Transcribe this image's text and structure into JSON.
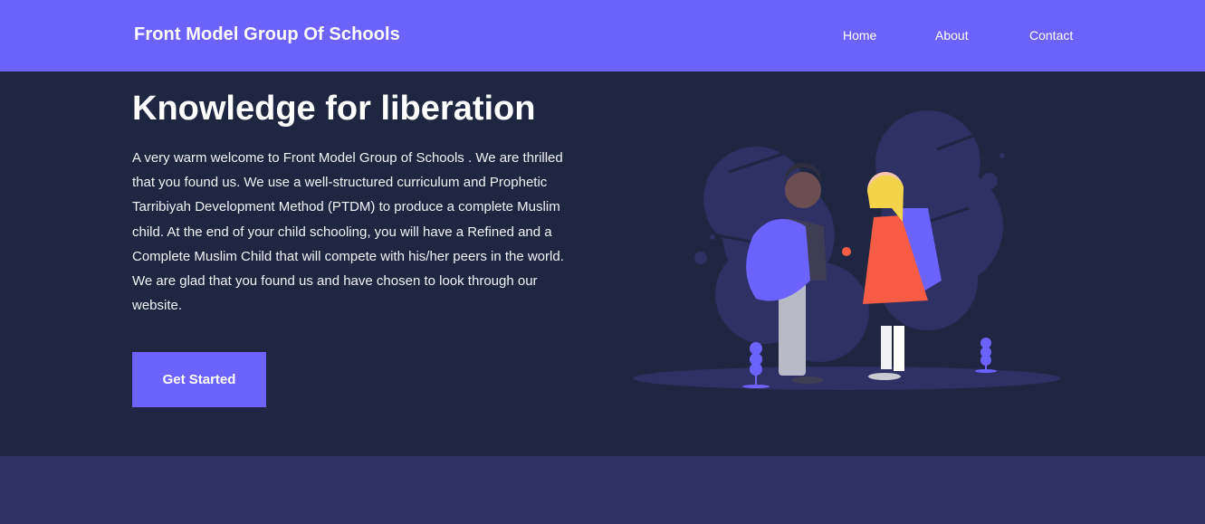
{
  "nav": {
    "brand": "Front Model Group Of Schools",
    "links": [
      "Home",
      "About",
      "Contact"
    ]
  },
  "hero": {
    "title": "Knowledge for liberation",
    "description": "A very warm welcome to Front Model Group of Schools . We are thrilled that you found us. We use a well-structured curriculum and Prophetic Tarribiyah Development Method (PTDM) to produce a complete Muslim child. At the end of your child schooling, you will have a Refined and a Complete Muslim Child that will compete with his/her peers in the world. We are glad that you found us and have chosen to look through our website.",
    "cta_label": "Get Started"
  },
  "colors": {
    "accent": "#6c63ff",
    "background": "#1f2641",
    "footer_band": "#2f3063"
  }
}
